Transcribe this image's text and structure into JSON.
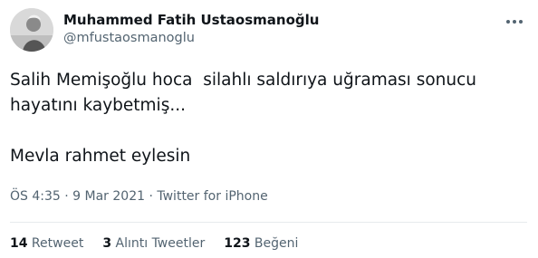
{
  "author": {
    "display_name": "Muhammed Fatih Ustaosmanoğlu",
    "handle": "@mfustaosmanoglu"
  },
  "tweet": {
    "text": "Salih Memişoğlu hoca  silahlı saldırıya uğraması sonucu\nhayatını kaybetmiş...\n\nMevla rahmet eylesin"
  },
  "meta": {
    "time": "ÖS 4:35",
    "separator1": " · ",
    "date": "9 Mar 2021",
    "separator2": " · ",
    "source": "Twitter for iPhone"
  },
  "stats": {
    "retweets_count": "14",
    "retweets_label": " Retweet",
    "quotes_count": "3",
    "quotes_label": " Alıntı Tweetler",
    "likes_count": "123",
    "likes_label": " Beğeni"
  },
  "icons": {
    "more": "more-icon",
    "avatar": "avatar-image"
  },
  "colors": {
    "text_primary": "#0f1419",
    "text_secondary": "#536471",
    "divider": "#e7ebed"
  }
}
